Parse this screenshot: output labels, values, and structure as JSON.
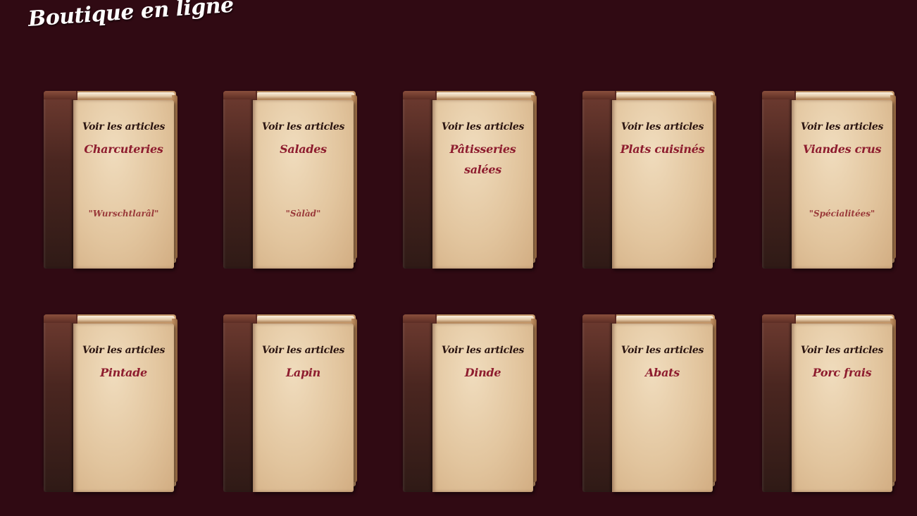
{
  "page": {
    "title": "Boutique en ligne"
  },
  "books": [
    {
      "label": "Voir les articles",
      "category": "Charcuteries",
      "nickname": "\"Wurschtlarâl\""
    },
    {
      "label": "Voir les articles",
      "category": "Salades",
      "nickname": "\"Sàlàd\""
    },
    {
      "label": "Voir les articles",
      "category": "Pâtisseries salées",
      "nickname": ""
    },
    {
      "label": "Voir les articles",
      "category": "Plats cuisinés",
      "nickname": ""
    },
    {
      "label": "Voir les articles",
      "category": "Viandes crus",
      "nickname": "\"Spécialitées\""
    },
    {
      "label": "Voir les articles",
      "category": "Pintade",
      "nickname": ""
    },
    {
      "label": "Voir les articles",
      "category": "Lapin",
      "nickname": ""
    },
    {
      "label": "Voir les articles",
      "category": "Dinde",
      "nickname": ""
    },
    {
      "label": "Voir les articles",
      "category": "Abats",
      "nickname": ""
    },
    {
      "label": "Voir les articles",
      "category": "Porc frais",
      "nickname": ""
    }
  ],
  "colors": {
    "background": "#300a13",
    "category_text": "#8e1d2f",
    "label_text": "#2a1410",
    "cover": "#e2c59e",
    "spine": "#4a2620"
  }
}
